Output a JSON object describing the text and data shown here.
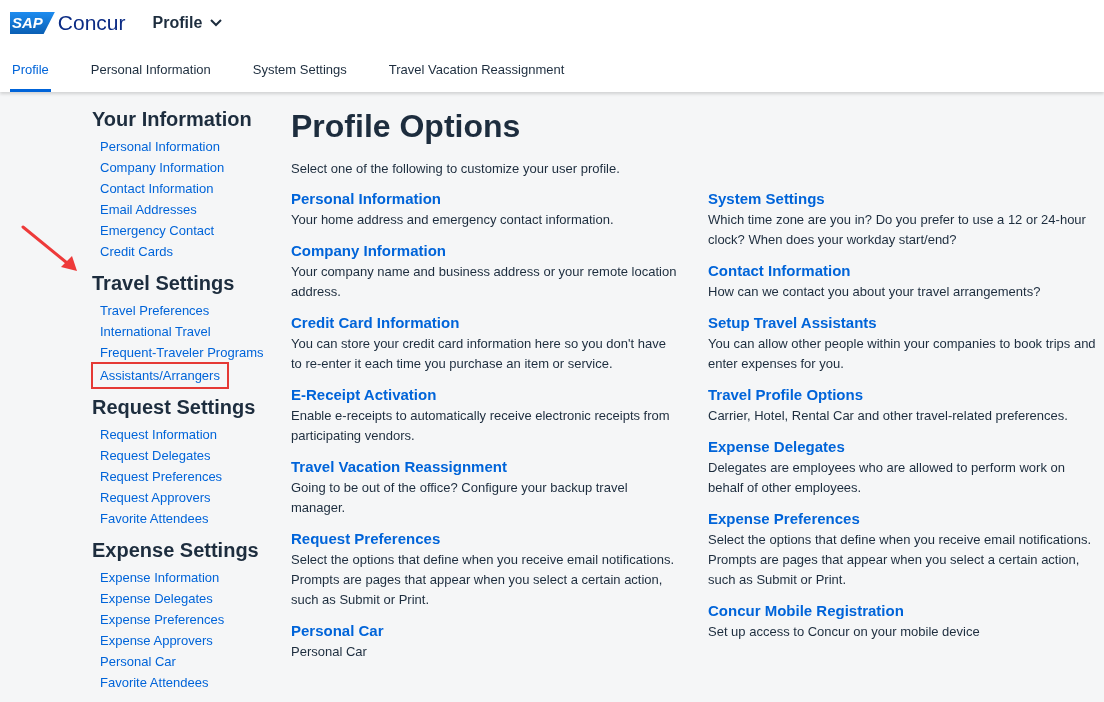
{
  "header": {
    "logo": {
      "mark": "SAP",
      "name": "Concur"
    },
    "menu": "Profile"
  },
  "tabs": [
    {
      "label": "Profile",
      "selected": true
    },
    {
      "label": "Personal Information",
      "selected": false
    },
    {
      "label": "System Settings",
      "selected": false
    },
    {
      "label": "Travel Vacation Reassignment",
      "selected": false
    }
  ],
  "sidebar": {
    "pointer_arrow": true,
    "sections": [
      {
        "title": "Your Information",
        "items": [
          {
            "label": "Personal Information",
            "highlighted": false
          },
          {
            "label": "Company Information",
            "highlighted": false
          },
          {
            "label": "Contact Information",
            "highlighted": false
          },
          {
            "label": "Email Addresses",
            "highlighted": false
          },
          {
            "label": "Emergency Contact",
            "highlighted": false
          },
          {
            "label": "Credit Cards",
            "highlighted": false
          }
        ]
      },
      {
        "title": "Travel Settings",
        "items": [
          {
            "label": "Travel Preferences",
            "highlighted": false
          },
          {
            "label": "International Travel",
            "highlighted": false
          },
          {
            "label": "Frequent-Traveler Programs",
            "highlighted": false
          },
          {
            "label": "Assistants/Arrangers",
            "highlighted": true
          }
        ]
      },
      {
        "title": "Request Settings",
        "items": [
          {
            "label": "Request Information",
            "highlighted": false
          },
          {
            "label": "Request Delegates",
            "highlighted": false
          },
          {
            "label": "Request Preferences",
            "highlighted": false
          },
          {
            "label": "Request Approvers",
            "highlighted": false
          },
          {
            "label": "Favorite Attendees",
            "highlighted": false
          }
        ]
      },
      {
        "title": "Expense Settings",
        "items": [
          {
            "label": "Expense Information",
            "highlighted": false
          },
          {
            "label": "Expense Delegates",
            "highlighted": false
          },
          {
            "label": "Expense Preferences",
            "highlighted": false
          },
          {
            "label": "Expense Approvers",
            "highlighted": false
          },
          {
            "label": "Personal Car",
            "highlighted": false
          },
          {
            "label": "Favorite Attendees",
            "highlighted": false
          }
        ]
      }
    ]
  },
  "main": {
    "title": "Profile Options",
    "intro": "Select one of the following to customize your user profile.",
    "columns": [
      [
        {
          "title": "Personal Information",
          "text": "Your home address and emergency contact information."
        },
        {
          "title": "Company Information",
          "text": "Your company name and business address or your remote location address."
        },
        {
          "title": "Credit Card Information",
          "text": "You can store your credit card information here so you don't have to re-enter it each time you purchase an item or service."
        },
        {
          "title": "E-Receipt Activation",
          "text": "Enable e-receipts to automatically receive electronic receipts from participating vendors."
        },
        {
          "title": "Travel Vacation Reassignment",
          "text": "Going to be out of the office? Configure your backup travel manager."
        },
        {
          "title": "Request Preferences",
          "text": "Select the options that define when you receive email notifications. Prompts are pages that appear when you select a certain action, such as Submit or Print."
        },
        {
          "title": "Personal Car",
          "text": "Personal Car"
        }
      ],
      [
        {
          "title": "System Settings",
          "text": "Which time zone are you in? Do you prefer to use a 12 or 24-hour clock? When does your workday start/end?"
        },
        {
          "title": "Contact Information",
          "text": "How can we contact you about your travel arrangements?"
        },
        {
          "title": "Setup Travel Assistants",
          "text": "You can allow other people within your companies to book trips and enter expenses for you."
        },
        {
          "title": "Travel Profile Options",
          "text": "Carrier, Hotel, Rental Car and other travel-related preferences."
        },
        {
          "title": "Expense Delegates",
          "text": "Delegates are employees who are allowed to perform work on behalf of other employees."
        },
        {
          "title": "Expense Preferences",
          "text": "Select the options that define when you receive email notifications. Prompts are pages that appear when you select a certain action, such as Submit or Print."
        },
        {
          "title": "Concur Mobile Registration",
          "text": "Set up access to Concur on your mobile device"
        }
      ]
    ]
  }
}
